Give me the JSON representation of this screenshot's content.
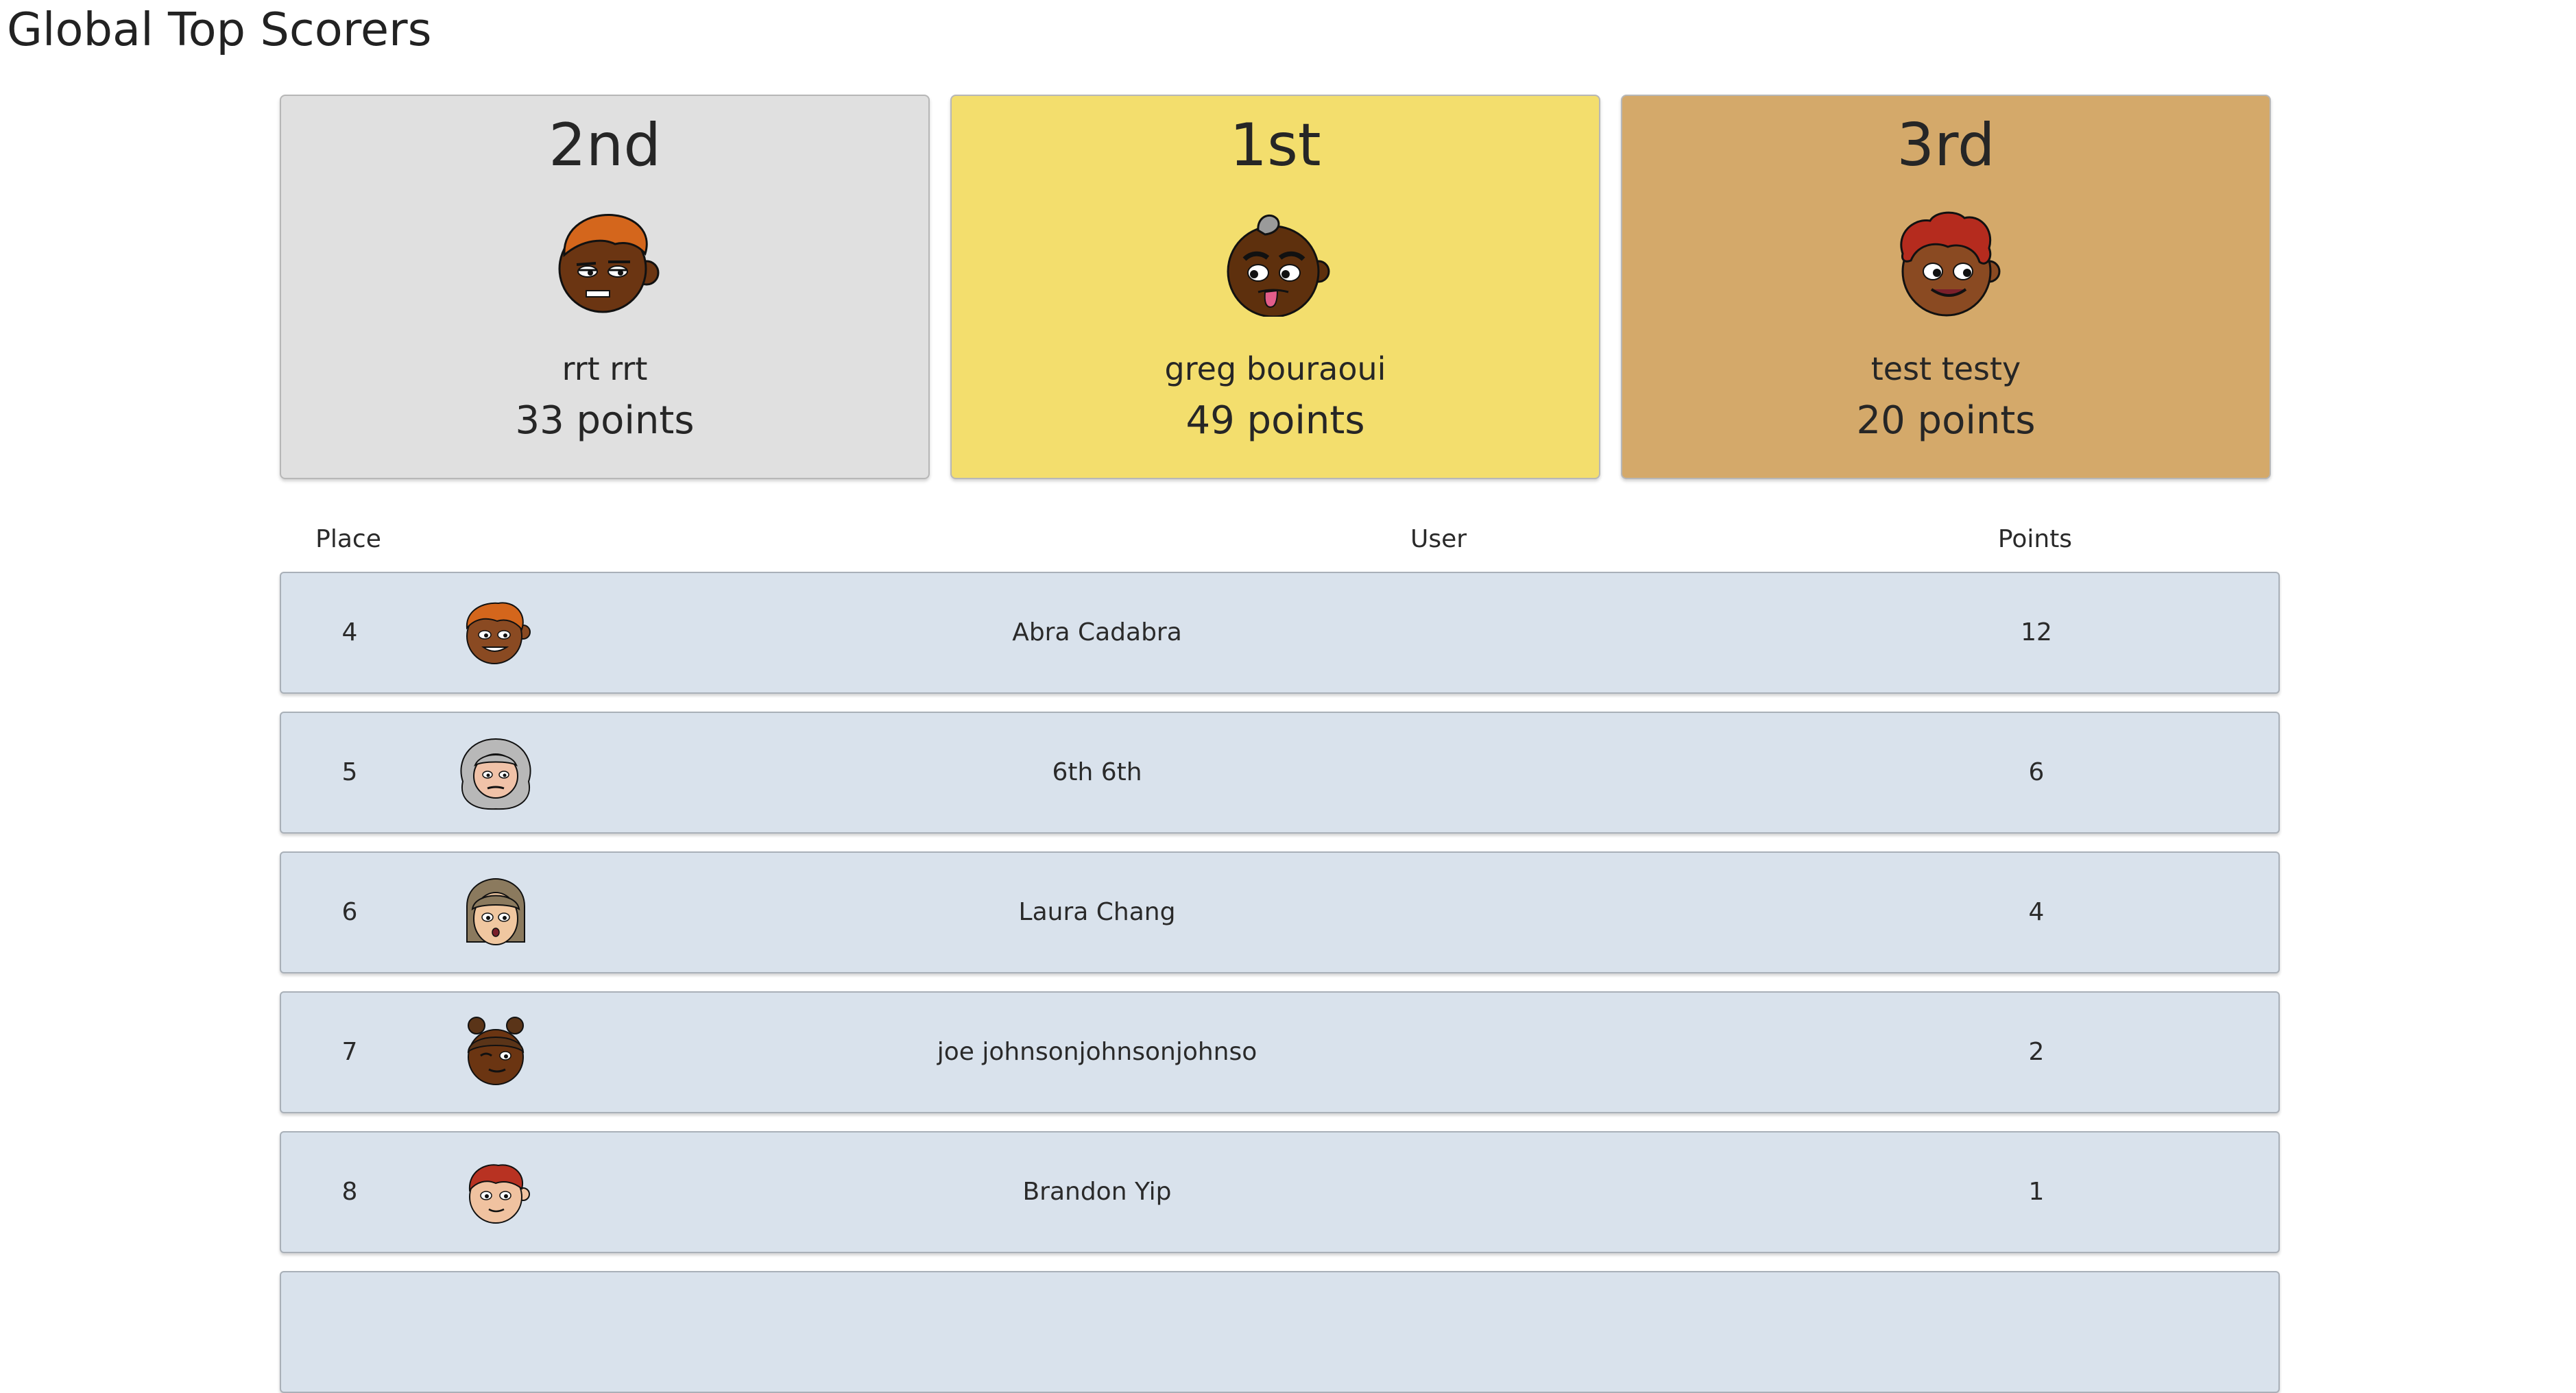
{
  "page": {
    "title": "Global Top Scorers"
  },
  "podium": [
    {
      "place": "2nd",
      "name": "rrt rrt",
      "points": "33 points",
      "avatar": "avatar-boy-orange-hair-icon",
      "bg": "#e0e0e0"
    },
    {
      "place": "1st",
      "name": "greg bouraoui",
      "points": "49 points",
      "avatar": "avatar-bald-tongue-out-icon",
      "bg": "#f3de6d"
    },
    {
      "place": "3rd",
      "name": "test testy",
      "points": "20 points",
      "avatar": "avatar-red-curly-hair-icon",
      "bg": "#d4a96a"
    }
  ],
  "table": {
    "headers": {
      "place": "Place",
      "user": "User",
      "points": "Points"
    },
    "rows": [
      {
        "place": "4",
        "user": "Abra Cadabra",
        "points": "12",
        "avatar": "avatar-orange-hair-grin-icon"
      },
      {
        "place": "5",
        "user": "6th 6th",
        "points": "6",
        "avatar": "avatar-gray-long-hair-icon"
      },
      {
        "place": "6",
        "user": "Laura Chang",
        "points": "4",
        "avatar": "avatar-brown-hair-bangs-icon"
      },
      {
        "place": "7",
        "user": "joe johnsonjohnsonjohnso",
        "points": "2",
        "avatar": "avatar-hair-buns-wink-icon"
      },
      {
        "place": "8",
        "user": "Brandon Yip",
        "points": "1",
        "avatar": "avatar-red-hair-light-skin-icon"
      }
    ]
  },
  "colors": {
    "first": "#f3de6d",
    "second": "#e0e0e0",
    "third": "#d4a96a",
    "row_bg": "#d9e2ec"
  }
}
